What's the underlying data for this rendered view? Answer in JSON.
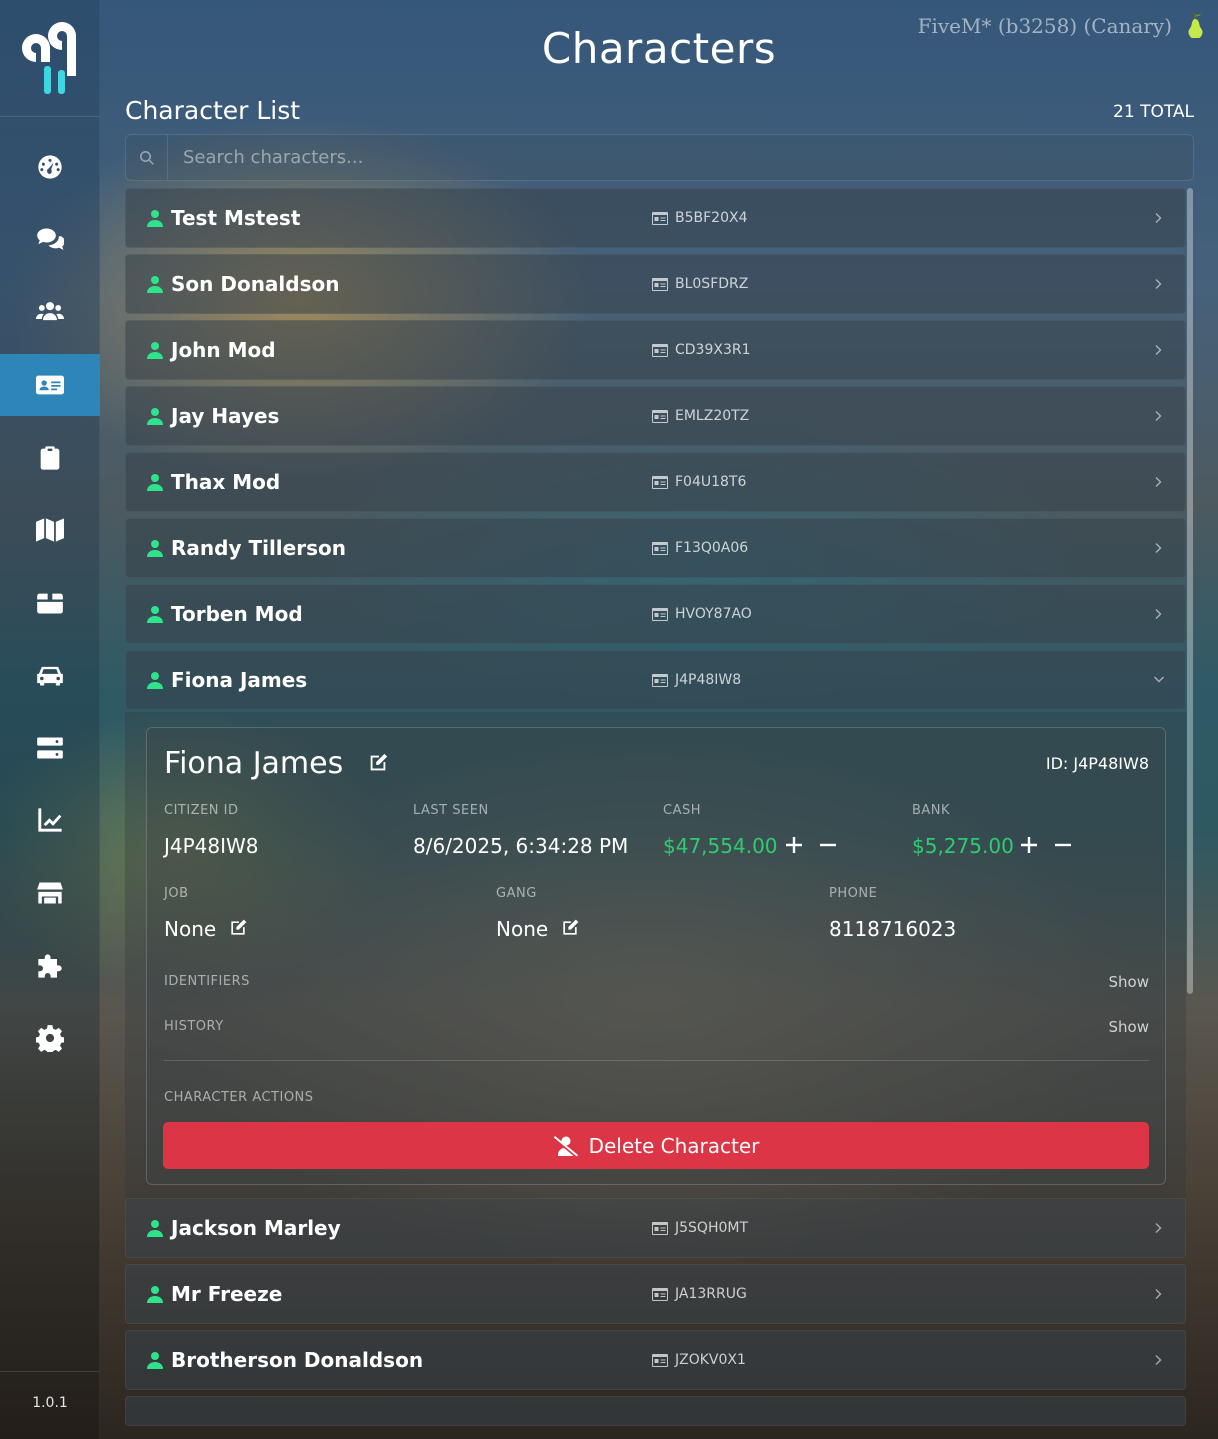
{
  "header": {
    "title": "Characters",
    "server": "FiveM* (b3258) (Canary)"
  },
  "sidebar": {
    "items": [
      {
        "name": "dashboard",
        "icon": "gauge-icon",
        "active": false
      },
      {
        "name": "chat",
        "icon": "comments-icon",
        "active": false
      },
      {
        "name": "players",
        "icon": "users-icon",
        "active": false
      },
      {
        "name": "characters",
        "icon": "id-card-icon",
        "active": true
      },
      {
        "name": "reports",
        "icon": "clipboard-icon",
        "active": false
      },
      {
        "name": "map",
        "icon": "map-icon",
        "active": false
      },
      {
        "name": "items",
        "icon": "box-icon",
        "active": false
      },
      {
        "name": "vehicles",
        "icon": "car-icon",
        "active": false
      },
      {
        "name": "server",
        "icon": "server-icon",
        "active": false
      },
      {
        "name": "analytics",
        "icon": "chart-line-icon",
        "active": false
      },
      {
        "name": "store",
        "icon": "store-icon",
        "active": false
      },
      {
        "name": "plugins",
        "icon": "puzzle-icon",
        "active": false
      },
      {
        "name": "settings",
        "icon": "gear-icon",
        "active": false
      }
    ],
    "version": "1.0.1"
  },
  "list": {
    "title": "Character List",
    "total": "21 TOTAL",
    "search_placeholder": "Search characters...",
    "rows_before": [
      {
        "name": "Test Mstest",
        "citizen_id": "B5BF20X4"
      },
      {
        "name": "Son Donaldson",
        "citizen_id": "BL0SFDRZ"
      },
      {
        "name": "John Mod",
        "citizen_id": "CD39X3R1"
      },
      {
        "name": "Jay Hayes",
        "citizen_id": "EMLZ20TZ"
      },
      {
        "name": "Thax Mod",
        "citizen_id": "F04U18T6"
      },
      {
        "name": "Randy Tillerson",
        "citizen_id": "F13Q0A06"
      },
      {
        "name": "Torben Mod",
        "citizen_id": "HVOY87AO"
      },
      {
        "name": "Fiona James",
        "citizen_id": "J4P48IW8",
        "expanded": true
      }
    ],
    "rows_after": [
      {
        "name": "Jackson Marley",
        "citizen_id": "J5SQH0MT"
      },
      {
        "name": "Mr Freeze",
        "citizen_id": "JA13RRUG"
      },
      {
        "name": "Brotherson Donaldson",
        "citizen_id": "JZOKV0X1"
      }
    ]
  },
  "detail": {
    "name": "Fiona James",
    "id_label": "ID: J4P48IW8",
    "citizen_id_label": "CITIZEN ID",
    "citizen_id": "J4P48IW8",
    "last_seen_label": "LAST SEEN",
    "last_seen": "8/6/2025, 6:34:28 PM",
    "cash_label": "CASH",
    "cash": "$47,554.00",
    "bank_label": "BANK",
    "bank": "$5,275.00",
    "job_label": "JOB",
    "job": "None",
    "gang_label": "GANG",
    "gang": "None",
    "phone_label": "PHONE",
    "phone": "8118716023",
    "identifiers_label": "IDENTIFIERS",
    "history_label": "HISTORY",
    "show_label": "Show",
    "actions_label": "CHARACTER ACTIONS",
    "delete_label": "Delete Character"
  },
  "colors": {
    "accent": "#2e86b8",
    "online": "#2ee48a",
    "money": "#2ecc71",
    "danger": "#dc3545"
  }
}
